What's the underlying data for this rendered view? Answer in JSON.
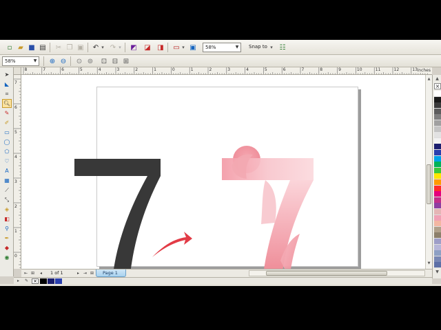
{
  "standard_toolbar": {
    "zoom_value": "58%",
    "snap_label": "Snap to",
    "icons": [
      "new-icon",
      "open-icon",
      "save-icon",
      "print-icon",
      "cut-icon",
      "copy-icon",
      "paste-icon",
      "undo-icon",
      "redo-icon",
      "import-icon",
      "export-icon",
      "launcher-icon",
      "full-screen-icon",
      "options-icon"
    ]
  },
  "property_bar": {
    "zoom_value": "58%"
  },
  "rulers": {
    "h_ticks": [
      "8",
      "7",
      "6",
      "5",
      "4",
      "3",
      "2",
      "1",
      "0",
      "1",
      "2",
      "3",
      "4",
      "5",
      "6",
      "7",
      "8",
      "9",
      "10",
      "11",
      "12",
      "13"
    ],
    "v_ticks": [
      "7",
      "6",
      "5",
      "4",
      "3",
      "2",
      "1",
      "0"
    ],
    "units": "inches"
  },
  "page_nav": {
    "page_count": "1 of 1",
    "page_tab": "Page 1"
  },
  "palette": {
    "colors": [
      "#ffffff",
      "#1a1a1a",
      "#3a3a3a",
      "#5c5c5c",
      "#7d7d7d",
      "#a0a0a0",
      "#c4c4c4",
      "#e2e2e2",
      "#f2f2f2",
      "#1b1e6e",
      "#2a3fae",
      "#00a2e8",
      "#00b259",
      "#3cc83c",
      "#ffe600",
      "#ff9a00",
      "#ff2b2b",
      "#e5007d",
      "#c12e8a",
      "#8e3ea1",
      "#e5b5b5",
      "#f0a0b4",
      "#f3b7a2",
      "#b0a08a",
      "#8c7f6a",
      "#9e9ec8",
      "#b6b6d8",
      "#8da0c4",
      "#7787b4",
      "#5c6fa6"
    ]
  },
  "doc_palette": {
    "colors": [
      "#000000",
      "#1b1e6e",
      "#2a3fae"
    ]
  }
}
